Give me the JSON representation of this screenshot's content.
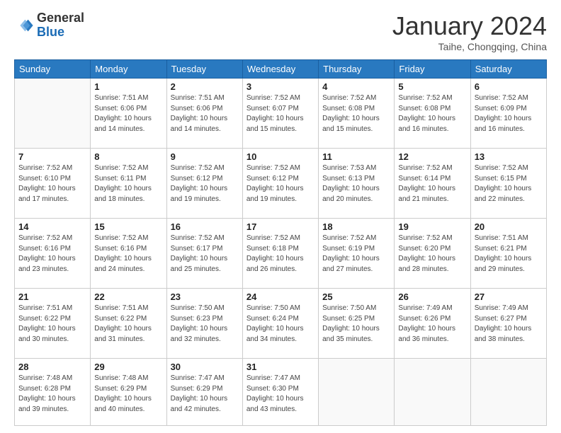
{
  "header": {
    "logo_general": "General",
    "logo_blue": "Blue",
    "month_title": "January 2024",
    "location": "Taihe, Chongqing, China"
  },
  "weekdays": [
    "Sunday",
    "Monday",
    "Tuesday",
    "Wednesday",
    "Thursday",
    "Friday",
    "Saturday"
  ],
  "weeks": [
    [
      {
        "day": "",
        "info": ""
      },
      {
        "day": "1",
        "info": "Sunrise: 7:51 AM\nSunset: 6:06 PM\nDaylight: 10 hours\nand 14 minutes."
      },
      {
        "day": "2",
        "info": "Sunrise: 7:51 AM\nSunset: 6:06 PM\nDaylight: 10 hours\nand 14 minutes."
      },
      {
        "day": "3",
        "info": "Sunrise: 7:52 AM\nSunset: 6:07 PM\nDaylight: 10 hours\nand 15 minutes."
      },
      {
        "day": "4",
        "info": "Sunrise: 7:52 AM\nSunset: 6:08 PM\nDaylight: 10 hours\nand 15 minutes."
      },
      {
        "day": "5",
        "info": "Sunrise: 7:52 AM\nSunset: 6:08 PM\nDaylight: 10 hours\nand 16 minutes."
      },
      {
        "day": "6",
        "info": "Sunrise: 7:52 AM\nSunset: 6:09 PM\nDaylight: 10 hours\nand 16 minutes."
      }
    ],
    [
      {
        "day": "7",
        "info": "Sunrise: 7:52 AM\nSunset: 6:10 PM\nDaylight: 10 hours\nand 17 minutes."
      },
      {
        "day": "8",
        "info": "Sunrise: 7:52 AM\nSunset: 6:11 PM\nDaylight: 10 hours\nand 18 minutes."
      },
      {
        "day": "9",
        "info": "Sunrise: 7:52 AM\nSunset: 6:12 PM\nDaylight: 10 hours\nand 19 minutes."
      },
      {
        "day": "10",
        "info": "Sunrise: 7:52 AM\nSunset: 6:12 PM\nDaylight: 10 hours\nand 19 minutes."
      },
      {
        "day": "11",
        "info": "Sunrise: 7:53 AM\nSunset: 6:13 PM\nDaylight: 10 hours\nand 20 minutes."
      },
      {
        "day": "12",
        "info": "Sunrise: 7:52 AM\nSunset: 6:14 PM\nDaylight: 10 hours\nand 21 minutes."
      },
      {
        "day": "13",
        "info": "Sunrise: 7:52 AM\nSunset: 6:15 PM\nDaylight: 10 hours\nand 22 minutes."
      }
    ],
    [
      {
        "day": "14",
        "info": "Sunrise: 7:52 AM\nSunset: 6:16 PM\nDaylight: 10 hours\nand 23 minutes."
      },
      {
        "day": "15",
        "info": "Sunrise: 7:52 AM\nSunset: 6:16 PM\nDaylight: 10 hours\nand 24 minutes."
      },
      {
        "day": "16",
        "info": "Sunrise: 7:52 AM\nSunset: 6:17 PM\nDaylight: 10 hours\nand 25 minutes."
      },
      {
        "day": "17",
        "info": "Sunrise: 7:52 AM\nSunset: 6:18 PM\nDaylight: 10 hours\nand 26 minutes."
      },
      {
        "day": "18",
        "info": "Sunrise: 7:52 AM\nSunset: 6:19 PM\nDaylight: 10 hours\nand 27 minutes."
      },
      {
        "day": "19",
        "info": "Sunrise: 7:52 AM\nSunset: 6:20 PM\nDaylight: 10 hours\nand 28 minutes."
      },
      {
        "day": "20",
        "info": "Sunrise: 7:51 AM\nSunset: 6:21 PM\nDaylight: 10 hours\nand 29 minutes."
      }
    ],
    [
      {
        "day": "21",
        "info": "Sunrise: 7:51 AM\nSunset: 6:22 PM\nDaylight: 10 hours\nand 30 minutes."
      },
      {
        "day": "22",
        "info": "Sunrise: 7:51 AM\nSunset: 6:22 PM\nDaylight: 10 hours\nand 31 minutes."
      },
      {
        "day": "23",
        "info": "Sunrise: 7:50 AM\nSunset: 6:23 PM\nDaylight: 10 hours\nand 32 minutes."
      },
      {
        "day": "24",
        "info": "Sunrise: 7:50 AM\nSunset: 6:24 PM\nDaylight: 10 hours\nand 34 minutes."
      },
      {
        "day": "25",
        "info": "Sunrise: 7:50 AM\nSunset: 6:25 PM\nDaylight: 10 hours\nand 35 minutes."
      },
      {
        "day": "26",
        "info": "Sunrise: 7:49 AM\nSunset: 6:26 PM\nDaylight: 10 hours\nand 36 minutes."
      },
      {
        "day": "27",
        "info": "Sunrise: 7:49 AM\nSunset: 6:27 PM\nDaylight: 10 hours\nand 38 minutes."
      }
    ],
    [
      {
        "day": "28",
        "info": "Sunrise: 7:48 AM\nSunset: 6:28 PM\nDaylight: 10 hours\nand 39 minutes."
      },
      {
        "day": "29",
        "info": "Sunrise: 7:48 AM\nSunset: 6:29 PM\nDaylight: 10 hours\nand 40 minutes."
      },
      {
        "day": "30",
        "info": "Sunrise: 7:47 AM\nSunset: 6:29 PM\nDaylight: 10 hours\nand 42 minutes."
      },
      {
        "day": "31",
        "info": "Sunrise: 7:47 AM\nSunset: 6:30 PM\nDaylight: 10 hours\nand 43 minutes."
      },
      {
        "day": "",
        "info": ""
      },
      {
        "day": "",
        "info": ""
      },
      {
        "day": "",
        "info": ""
      }
    ]
  ]
}
